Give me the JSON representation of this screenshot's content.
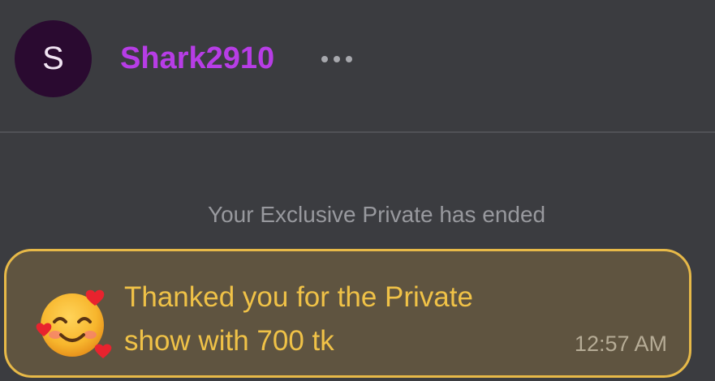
{
  "header": {
    "avatar_initial": "S",
    "username": "Shark2910",
    "more_icon": "ellipsis-icon"
  },
  "system_message": "Your Exclusive Private has ended",
  "tip_message": {
    "emoji": "smiling-face-with-hearts-icon",
    "line1": "Thanked you for the Private",
    "line2": "show with 700 tk",
    "time": "12:57 AM",
    "accent_color": "#e7b948"
  },
  "colors": {
    "background": "#3b3c40",
    "username": "#b73de6",
    "bubble_text": "#f0c247"
  }
}
